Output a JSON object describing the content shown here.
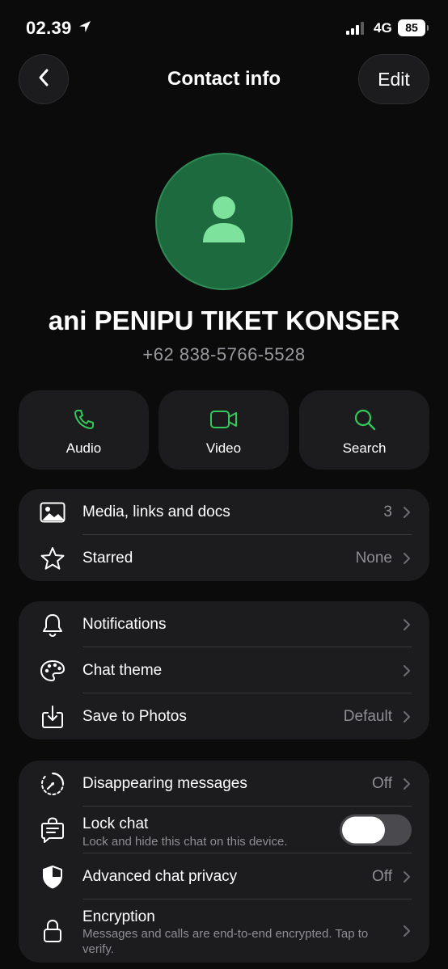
{
  "status_bar": {
    "time": "02.39",
    "network": "4G",
    "battery": "85"
  },
  "nav": {
    "title": "Contact info",
    "edit_label": "Edit"
  },
  "contact": {
    "name": "ani PENIPU TIKET KONSER",
    "phone": "+62 838-5766-5528"
  },
  "actions": [
    {
      "label": "Audio",
      "icon": "phone-icon"
    },
    {
      "label": "Video",
      "icon": "video-icon"
    },
    {
      "label": "Search",
      "icon": "search-icon"
    }
  ],
  "media_section": {
    "rows": [
      {
        "label": "Media, links and docs",
        "value": "3",
        "icon": "image-icon"
      },
      {
        "label": "Starred",
        "value": "None",
        "icon": "star-icon"
      }
    ]
  },
  "settings_section": {
    "rows": [
      {
        "label": "Notifications",
        "value": "",
        "icon": "bell-icon"
      },
      {
        "label": "Chat theme",
        "value": "",
        "icon": "palette-icon"
      },
      {
        "label": "Save to Photos",
        "value": "Default",
        "icon": "download-icon"
      }
    ]
  },
  "privacy_section": {
    "disappearing": {
      "label": "Disappearing messages",
      "value": "Off",
      "icon": "timer-icon"
    },
    "lock_chat": {
      "label": "Lock chat",
      "subtitle": "Lock and hide this chat on this device.",
      "toggle_on": false,
      "icon": "chat-lock-icon"
    },
    "advanced": {
      "label": "Advanced chat privacy",
      "value": "Off",
      "icon": "shield-icon"
    },
    "encryption": {
      "label": "Encryption",
      "subtitle": "Messages and calls are end-to-end encrypted. Tap to verify.",
      "icon": "lock-icon"
    }
  },
  "colors": {
    "accent": "#34c759",
    "avatar_bg": "#1d6a3e",
    "card_bg": "#1c1c1e",
    "background": "#0b0b0b"
  }
}
